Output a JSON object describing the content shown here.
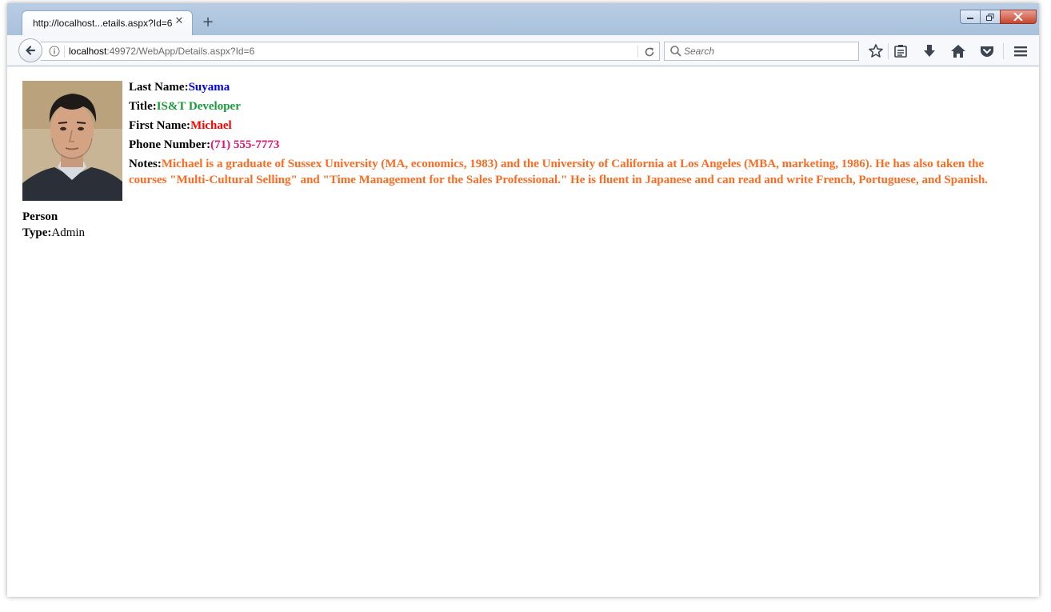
{
  "browser": {
    "tab": {
      "title": "http://localhost...etails.aspx?Id=6",
      "close_glyph": "✕"
    },
    "new_tab_glyph": "+",
    "url": {
      "host": "localhost",
      "rest": ":49972/WebApp/Details.aspx?Id=6"
    },
    "search": {
      "placeholder": "Search"
    },
    "icons": [
      "back-arrow-icon",
      "info-icon",
      "reload-icon",
      "search-icon",
      "bookmark-star-icon",
      "reading-list-icon",
      "download-icon",
      "home-icon",
      "pocket-icon",
      "menu-icon"
    ]
  },
  "details": {
    "last_name": {
      "label": "Last Name:",
      "value": "Suyama"
    },
    "title": {
      "label": "Title:",
      "value": "IS&T Developer"
    },
    "first_name": {
      "label": "First Name:",
      "value": "Michael"
    },
    "phone": {
      "label": "Phone Number:",
      "value": "(71) 555-7773"
    },
    "notes": {
      "label": "Notes:",
      "value": "Michael is a graduate of Sussex University (MA, economics, 1983) and the University of California at Los Angeles (MBA, marketing, 1986). He has also taken the courses \"Multi-Cultural Selling\" and \"Time Management for the Sales Professional.\" He is fluent in Japanese and can read and write French, Portuguese, and Spanish."
    },
    "person_type": {
      "label": "Person Type:",
      "value": "Admin"
    }
  },
  "colors": {
    "last_name": "#0000ff",
    "title": "#1a9a3a",
    "first_name": "#ff0000",
    "phone": "#e8126e",
    "notes": "#ff6a21"
  }
}
